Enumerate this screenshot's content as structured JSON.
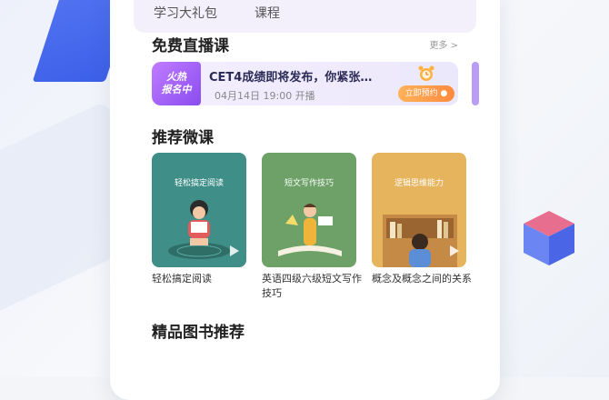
{
  "top_tabs": [
    "学习大礼包",
    "课程"
  ],
  "free_live": {
    "title": "免费直播课",
    "more": "更多 >",
    "card": {
      "badge_line1": "火热",
      "badge_line2": "报名中",
      "title": "CET4成绩即将发布，你紧张…",
      "time": "04月14日 19:00 开播",
      "button": "立即预约 ●",
      "alarm_icon": "alarm-clock-icon"
    }
  },
  "recommended": {
    "title": "推荐微课",
    "courses": [
      {
        "cover_label": "轻松搞定阅读",
        "caption": "轻松搞定阅读",
        "cover_color": "#3f8f88"
      },
      {
        "cover_label": "短文写作技巧",
        "caption": "英语四级六级短文写作技巧",
        "cover_color": "#6da168"
      },
      {
        "cover_label": "逻辑思维能力",
        "caption": "概念及概念之间的关系",
        "cover_color": "#e6b45d"
      }
    ]
  },
  "books": {
    "title": "精品图书推荐"
  },
  "colors": {
    "accent_purple": "#8a4cf0",
    "accent_orange": "#ff8a3d",
    "background": "#f4f5f8"
  }
}
